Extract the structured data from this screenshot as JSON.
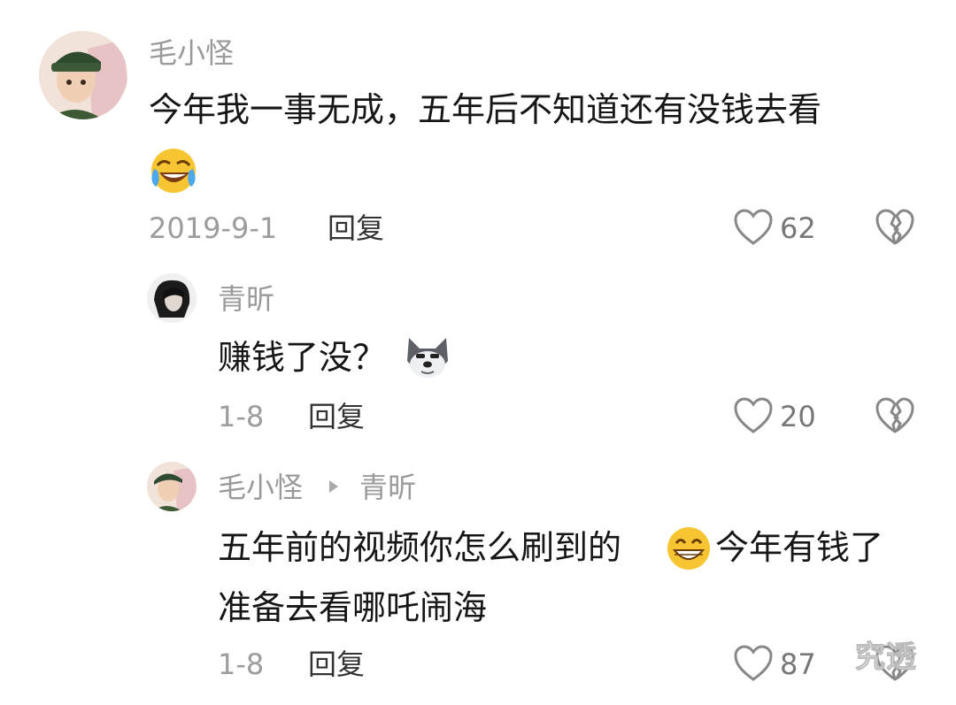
{
  "comments": [
    {
      "user": "毛小怪",
      "text": "今年我一事无成，五年后不知道还有没钱去看",
      "emoji": "laughing-crying-emoji",
      "date": "2019-9-1",
      "reply_label": "回复",
      "likes": "62"
    },
    {
      "user": "青昕",
      "text": "赚钱了没？",
      "emoji": "dog-emoji",
      "date": "1-8",
      "reply_label": "回复",
      "likes": "20"
    },
    {
      "user": "毛小怪",
      "reply_to": "青昕",
      "text_line1_a": "五年前的视频你怎么刷到的",
      "emoji": "grinning-emoji",
      "text_line1_b": "今年有钱了",
      "text_line2": "准备去看哪吒闹海",
      "date": "1-8",
      "reply_label": "回复",
      "likes": "87"
    }
  ],
  "watermark": "究透",
  "colors": {
    "secondary_text": "#9a9a9a",
    "primary_text": "#161616",
    "icon": "#8a8a8a"
  }
}
